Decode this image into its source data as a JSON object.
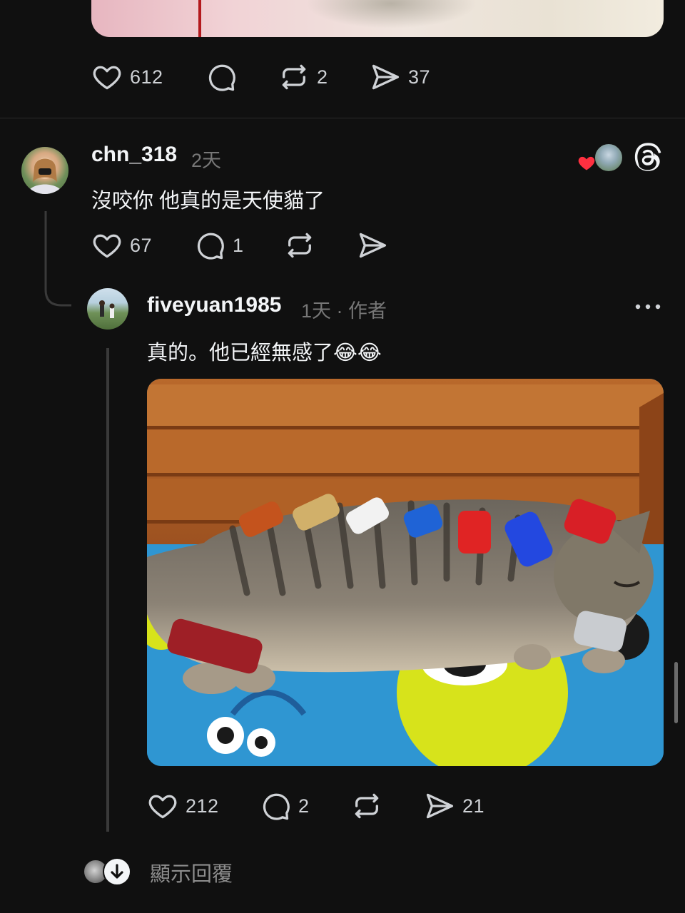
{
  "top_post": {
    "likes": "612",
    "reposts": "2",
    "shares": "37"
  },
  "comment": {
    "username": "chn_318",
    "time": "2天",
    "text": "沒咬你 他真的是天使貓了",
    "likes": "67",
    "replies": "1"
  },
  "reply": {
    "username": "fiveyuan1985",
    "meta": "1天 · 作者",
    "text": "真的。他已經無感了😂😂",
    "likes": "212",
    "replies": "2",
    "shares": "21"
  },
  "show_replies_label": "顯示回覆",
  "icons": {
    "like": "heart-icon",
    "comment": "comment-icon",
    "repost": "repost-icon",
    "share": "send-icon",
    "threads": "threads-logo-icon",
    "more": "more-icon",
    "liked_badge": "heart-badge-icon"
  },
  "colors": {
    "background": "#101010",
    "text": "#f3f5f7",
    "secondary": "#777777",
    "liked_red": "#ff3040"
  }
}
